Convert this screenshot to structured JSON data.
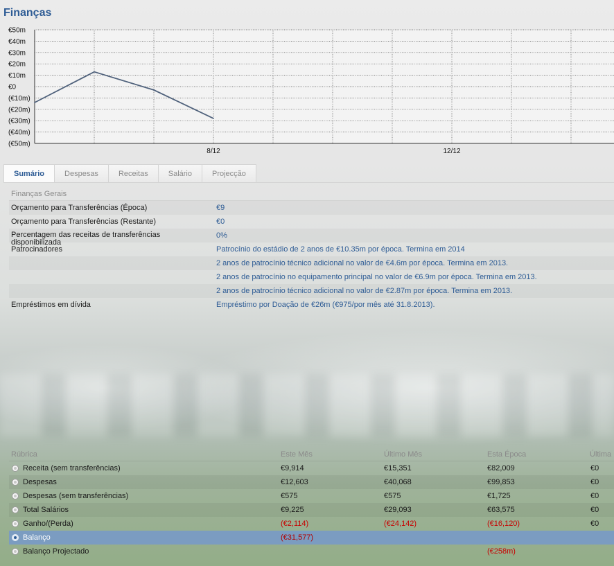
{
  "page": {
    "title": "Finanças"
  },
  "chart_data": {
    "type": "line",
    "y_ticks": [
      "€50m",
      "€40m",
      "€30m",
      "€20m",
      "€10m",
      "€0",
      "(€10m)",
      "(€20m)",
      "(€30m)",
      "(€40m)",
      "(€50m)"
    ],
    "x_ticks": [
      "8/12",
      "12/12"
    ],
    "ylim": [
      -50,
      50
    ],
    "grid": true,
    "series": [
      {
        "values": [
          -14,
          13,
          -3,
          -28
        ]
      }
    ],
    "line_color": "#50627c"
  },
  "tabs": [
    {
      "label": "Sumário",
      "active": true
    },
    {
      "label": "Despesas",
      "active": false
    },
    {
      "label": "Receitas",
      "active": false
    },
    {
      "label": "Salário",
      "active": false
    },
    {
      "label": "Projecção",
      "active": false
    }
  ],
  "summary": {
    "section_title": "Finanças Gerais",
    "rows": [
      {
        "label": "Orçamento para Transferências (Época)",
        "value": "€9"
      },
      {
        "label": "Orçamento para Transferências (Restante)",
        "value": "€0"
      },
      {
        "label": "Percentagem das receitas de transferências disponibilizada",
        "value": "0%"
      },
      {
        "label": "Patrocinadores",
        "value": "Patrocínio do estádio de 2 anos de €10.35m por época. Termina em 2014"
      },
      {
        "label": "",
        "value": "2 anos de patrocínio técnico adicional no valor de €4.6m por época. Termina em 2013."
      },
      {
        "label": "",
        "value": "2 anos de patrocínio no equipamento principal no valor de €6.9m por época. Termina em 2013."
      },
      {
        "label": "",
        "value": "2 anos de patrocínio técnico adicional no valor de €2.87m por época. Termina em 2013."
      },
      {
        "label": "Empréstimos em dívida",
        "value": "Empréstimo por Doação de €26m (€975/por mês até 31.8.2013)."
      }
    ]
  },
  "finance_table": {
    "headers": [
      "Rúbrica",
      "Este Mês",
      "Último Mês",
      "Esta Época",
      "Última"
    ],
    "rows": [
      {
        "name": "Receita (sem transferências)",
        "cells": [
          "€9,914",
          "€15,351",
          "€82,009",
          "€0"
        ],
        "negative": [
          false,
          false,
          false,
          false
        ],
        "selected": false
      },
      {
        "name": "Despesas",
        "cells": [
          "€12,603",
          "€40,068",
          "€99,853",
          "€0"
        ],
        "negative": [
          false,
          false,
          false,
          false
        ],
        "selected": false
      },
      {
        "name": "Despesas (sem transferências)",
        "cells": [
          "€575",
          "€575",
          "€1,725",
          "€0"
        ],
        "negative": [
          false,
          false,
          false,
          false
        ],
        "selected": false
      },
      {
        "name": "Total Salários",
        "cells": [
          "€9,225",
          "€29,093",
          "€63,575",
          "€0"
        ],
        "negative": [
          false,
          false,
          false,
          false
        ],
        "selected": false
      },
      {
        "name": "Ganho/(Perda)",
        "cells": [
          "(€2,114)",
          "(€24,142)",
          "(€16,120)",
          "€0"
        ],
        "negative": [
          true,
          true,
          true,
          false
        ],
        "selected": false
      },
      {
        "name": "Balanço",
        "cells": [
          "(€31,577)",
          "",
          "",
          ""
        ],
        "negative": [
          true,
          false,
          false,
          false
        ],
        "selected": true
      },
      {
        "name": "Balanço Projectado",
        "cells": [
          "",
          "",
          "(€258m)",
          ""
        ],
        "negative": [
          false,
          false,
          true,
          false
        ],
        "selected": false
      }
    ]
  }
}
